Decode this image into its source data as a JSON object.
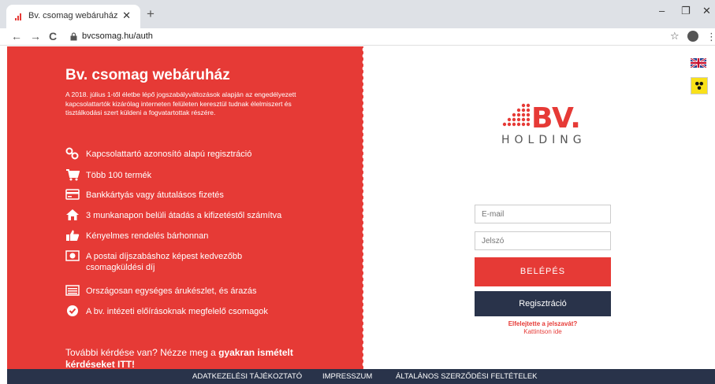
{
  "browser": {
    "tab_title": "Bv. csomag webáruház",
    "tab_close": "✕",
    "new_tab": "+",
    "url": "bvcsomag.hu/auth",
    "back": "←",
    "forward": "→",
    "reload": "C",
    "star": "☆",
    "menu": "⋮",
    "minimize": "–",
    "restore": "❐",
    "close": "✕"
  },
  "left": {
    "title": "Bv. csomag webáruház",
    "intro": "A 2018. július 1-től életbe lépő jogszabályváltozások alapján az engedélyezett kapcsolattartók kizárólag interneten felületen keresztül tudnak élelmiszert és tisztálkodási szert küldeni a fogvatartottak részére.",
    "features": [
      {
        "icon": "link-icon",
        "text": "Kapcsolattartó azonosító alapú regisztráció"
      },
      {
        "icon": "cart-icon",
        "text": "Több 100 termék"
      },
      {
        "icon": "credit-card-icon",
        "text": "Bankkártyás vagy átutalásos fizetés"
      },
      {
        "icon": "home-icon",
        "text": "3 munkanapon belüli átadás a kifizetéstől számítva"
      },
      {
        "icon": "thumbs-up-icon",
        "text": "Kényelmes rendelés bárhonnan"
      },
      {
        "icon": "money-icon",
        "text": "A postai díjszabáshoz képest kedvezőbb csomagküldési díj"
      },
      {
        "icon": "list-icon",
        "text": "Országosan egységes árukészlet, és árazás"
      },
      {
        "icon": "check-circle-icon",
        "text": "A bv. intézeti előírásoknak megfelelő csomagok"
      }
    ],
    "more_prefix": "További kérdése van? Nézze meg a ",
    "more_bold": "gyakran ismételt kérdéseket ITT!"
  },
  "logo": {
    "text": "HOLDING",
    "initials": "BV.",
    "color": "#e63a36"
  },
  "form": {
    "email_placeholder": "E-mail",
    "password_placeholder": "Jelszó",
    "login_label": "BELÉPÉS",
    "register_label": "Regisztráció",
    "forgot_question": "Elfelejtette a jelszavát?",
    "forgot_cta": "Kattintson ide"
  },
  "footer": {
    "links": [
      "ADATKEZELÉSI TÁJÉKOZTATÓ",
      "IMPRESSZUM",
      "ÁLTALÁNOS SZERZŐDÉSI FELTÉTELEK"
    ]
  },
  "colors": {
    "accent_red": "#e63a36",
    "navy": "#29334a"
  }
}
